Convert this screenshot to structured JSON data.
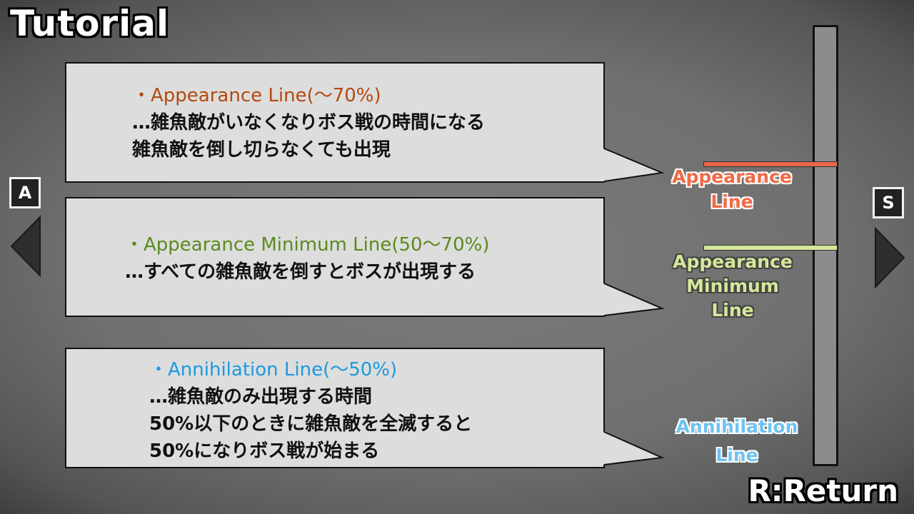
{
  "title": "Tutorial",
  "bubbles": [
    {
      "head": "・Appearance Line(～70%)",
      "lines": [
        "…雑魚敵がいなくなりボス戦の時間になる",
        "雑魚敵を倒し切らなくても出現"
      ],
      "color": "#b24a0e"
    },
    {
      "head": "・Appearance Minimum Line(50～70%)",
      "lines": [
        "…すべての雑魚敵を倒すとボスが出現する"
      ],
      "color": "#5b8a1e"
    },
    {
      "head": "・Annihilation Line(～50%)",
      "lines": [
        "…雑魚敵のみ出現する時間",
        "50%以下のときに雑魚敵を全滅すると",
        "50%になりボス戦が始まる"
      ],
      "color": "#1a9ae0"
    }
  ],
  "gauge": {
    "appearance_label": [
      "Appearance",
      "Line"
    ],
    "minimum_label": [
      "Appearance",
      "Minimum",
      "Line"
    ],
    "annihilation_label": [
      "Annihilation",
      "Line"
    ],
    "appearance_color": "#f06a45",
    "minimum_color": "#d4e89a",
    "annihilation_color": "#6ec3f0"
  },
  "nav": {
    "left_key": "A",
    "right_key": "S"
  },
  "return_label": "R:Return"
}
